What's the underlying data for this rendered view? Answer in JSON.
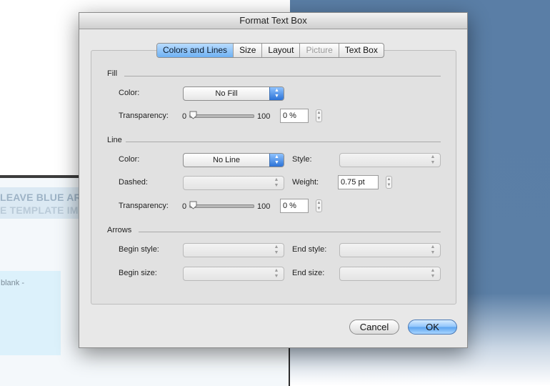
{
  "background": {
    "banner_line1": "LEAVE BLUE AR",
    "banner_line2": "E TEMPLATE IMA",
    "box_text": "blank -"
  },
  "dialog": {
    "title": "Format Text Box",
    "tabs": [
      {
        "label": "Colors and Lines",
        "active": true
      },
      {
        "label": "Size"
      },
      {
        "label": "Layout"
      },
      {
        "label": "Picture",
        "disabled": true
      },
      {
        "label": "Text Box"
      }
    ],
    "fill": {
      "heading": "Fill",
      "color_label": "Color:",
      "color_value": "No Fill",
      "transparency_label": "Transparency:",
      "slider_min": "0",
      "slider_max": "100",
      "transparency_value": "0 %"
    },
    "line": {
      "heading": "Line",
      "color_label": "Color:",
      "color_value": "No Line",
      "style_label": "Style:",
      "style_value": "",
      "dashed_label": "Dashed:",
      "dashed_value": "",
      "weight_label": "Weight:",
      "weight_value": "0.75 pt",
      "transparency_label": "Transparency:",
      "slider_min": "0",
      "slider_max": "100",
      "transparency_value": "0 %"
    },
    "arrows": {
      "heading": "Arrows",
      "begin_style_label": "Begin style:",
      "end_style_label": "End style:",
      "begin_size_label": "Begin size:",
      "end_size_label": "End size:"
    },
    "buttons": {
      "cancel": "Cancel",
      "ok": "OK"
    }
  },
  "colors": {
    "accent": "#4f9ff0",
    "desktop_blue": "#5b7fa6"
  }
}
